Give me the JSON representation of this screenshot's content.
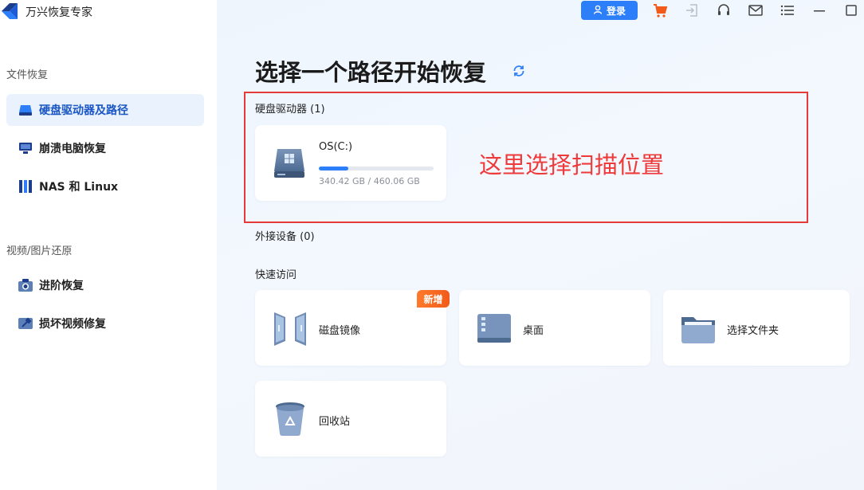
{
  "app": {
    "title": "万兴恢复专家"
  },
  "sidebar": {
    "section1": "文件恢复",
    "items1": [
      {
        "label": "硬盘驱动器及路径",
        "icon": "hard-drive-icon",
        "active": true
      },
      {
        "label": "崩溃电脑恢复",
        "icon": "monitor-icon",
        "active": false
      },
      {
        "label": "NAS 和 Linux",
        "icon": "nas-icon",
        "active": false
      }
    ],
    "section2": "视频/图片还原",
    "items2": [
      {
        "label": "进阶恢复",
        "icon": "camera-icon",
        "active": false
      },
      {
        "label": "损坏视频修复",
        "icon": "video-repair-icon",
        "active": false
      }
    ]
  },
  "topbar": {
    "login_label": "登录",
    "icons": [
      "cart-icon",
      "export-icon",
      "headset-icon",
      "mail-icon",
      "menu-icon",
      "minimize-icon",
      "maximize-icon"
    ]
  },
  "main": {
    "title": "选择一个路径开始恢复",
    "drives_label": "硬盘驱动器 (1)",
    "drive": {
      "name": "OS(C:)",
      "size": "340.42 GB / 460.06 GB",
      "used_fraction": 0.26
    },
    "external_label": "外接设备 (0)",
    "quick_label": "快速访问",
    "quick_items": [
      {
        "label": "磁盘镜像",
        "icon": "disk-image-icon"
      },
      {
        "label": "桌面",
        "icon": "desktop-icon"
      },
      {
        "label": "选择文件夹",
        "icon": "folder-icon"
      },
      {
        "label": "回收站",
        "icon": "recycle-bin-icon"
      }
    ],
    "new_badge": "新增",
    "annotation": "这里选择扫描位置"
  },
  "colors": {
    "accent": "#2d7ff9",
    "annotation_red": "#e53a3a",
    "badge_orange": "#f25a1a",
    "active_bg": "#e9f2fd"
  }
}
